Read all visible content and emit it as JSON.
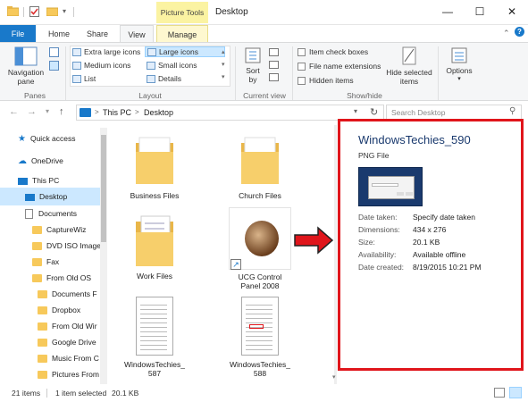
{
  "titlebar": {
    "context_tab": "Picture Tools",
    "title": "Desktop",
    "minimize": "—",
    "maximize": "☐",
    "close": "✕"
  },
  "tabs": {
    "file": "File",
    "home": "Home",
    "share": "Share",
    "view": "View",
    "manage": "Manage"
  },
  "ribbon": {
    "nav_pane": "Navigation",
    "nav_pane_2": "pane",
    "group_panes": "Panes",
    "extra_large": "Extra large icons",
    "large": "Large icons",
    "medium": "Medium icons",
    "small": "Small icons",
    "list": "List",
    "details": "Details",
    "group_layout": "Layout",
    "sort": "Sort",
    "sort_2": "by",
    "group_current_view": "Current view",
    "item_check_boxes": "Item check boxes",
    "file_name_ext": "File name extensions",
    "hidden_items": "Hidden items",
    "hide_selected": "Hide selected",
    "hide_selected_2": "items",
    "group_showhide": "Show/hide",
    "options": "Options"
  },
  "address": {
    "this_pc": "This PC",
    "sep": ">",
    "desktop": "Desktop",
    "search_placeholder": "Search Desktop"
  },
  "nav": [
    {
      "label": "Quick access"
    },
    {
      "label": "OneDrive"
    },
    {
      "label": "This PC"
    },
    {
      "label": "Desktop"
    },
    {
      "label": "Documents"
    },
    {
      "label": "CaptureWiz"
    },
    {
      "label": "DVD ISO Image"
    },
    {
      "label": "Fax"
    },
    {
      "label": "From Old OS"
    },
    {
      "label": "Documents F"
    },
    {
      "label": "Dropbox"
    },
    {
      "label": "From Old Wir"
    },
    {
      "label": "Google Drive"
    },
    {
      "label": "Music From C"
    },
    {
      "label": "Pictures From"
    }
  ],
  "files": [
    {
      "label": "Business Files"
    },
    {
      "label": "Church Files"
    },
    {
      "label": "Work Files"
    },
    {
      "label": "UCG Control",
      "label2": "Panel 2008"
    },
    {
      "label": "WindowsTechies_",
      "label2": "587"
    },
    {
      "label": "WindowsTechies_",
      "label2": "588"
    }
  ],
  "preview": {
    "name": "WindowsTechies_590",
    "type": "PNG File",
    "date_taken_label": "Date taken:",
    "date_taken": "Specify date taken",
    "dimensions_label": "Dimensions:",
    "dimensions": "434 x 276",
    "size_label": "Size:",
    "size": "20.1 KB",
    "availability_label": "Availability:",
    "availability": "Available offline",
    "date_created_label": "Date created:",
    "date_created": "8/19/2015 10:21 PM"
  },
  "status": {
    "count": "21 items",
    "selected": "1 item selected",
    "size": "20.1 KB"
  },
  "colors": {
    "file_tab": "#1979ca",
    "highlight": "#cce8ff",
    "accent_red": "#e0151b",
    "folder": "#f7c95b"
  }
}
